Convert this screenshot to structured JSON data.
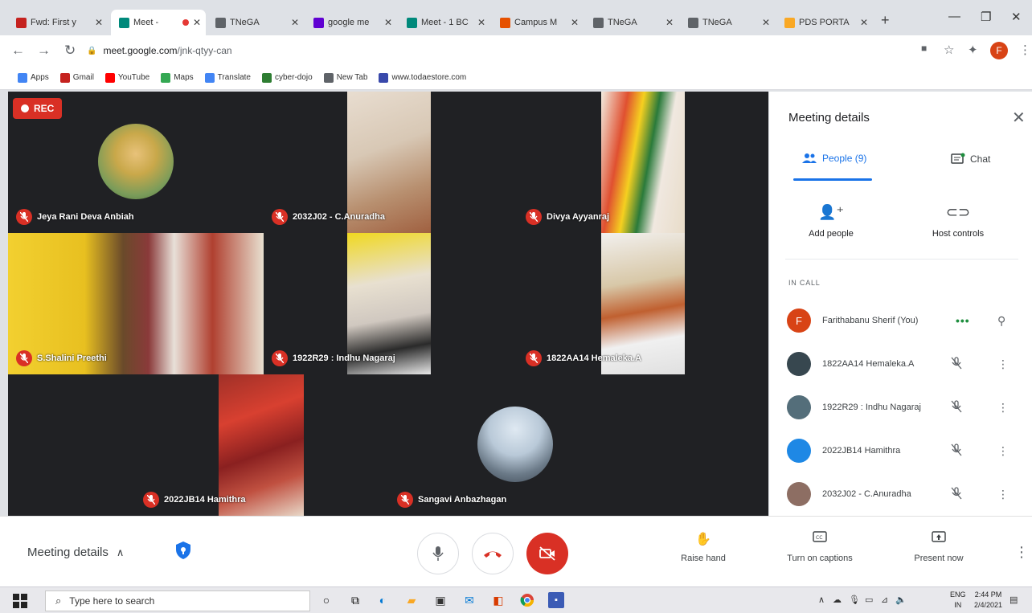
{
  "browser": {
    "tabs": [
      {
        "title": "Fwd: First y",
        "favicon": "gmail-icon",
        "color": "#c5221f"
      },
      {
        "title": "Meet - ",
        "favicon": "meet-icon",
        "color": "#00897b",
        "active": true,
        "recording": true
      },
      {
        "title": "TNeGA",
        "favicon": "globe-icon",
        "color": "#5f6368"
      },
      {
        "title": "google me",
        "favicon": "yahoo-icon",
        "color": "#6001d2"
      },
      {
        "title": "Meet - 1 BC",
        "favicon": "meet-icon",
        "color": "#00897b"
      },
      {
        "title": "Campus M",
        "favicon": "campus-icon",
        "color": "#e65100"
      },
      {
        "title": "TNeGA",
        "favicon": "globe-icon",
        "color": "#5f6368"
      },
      {
        "title": "TNeGA",
        "favicon": "globe-icon",
        "color": "#5f6368"
      },
      {
        "title": "PDS PORTA",
        "favicon": "pds-icon",
        "color": "#f9a825"
      }
    ],
    "url_domain": "meet.google.com",
    "url_path": "/jnk-qtyy-can",
    "profile_initial": "F",
    "bookmarks": [
      {
        "label": "Apps",
        "icon": "apps-grid-icon",
        "color": "#4285f4"
      },
      {
        "label": "Gmail",
        "icon": "gmail-icon",
        "color": "#c5221f"
      },
      {
        "label": "YouTube",
        "icon": "youtube-icon",
        "color": "#ff0000"
      },
      {
        "label": "Maps",
        "icon": "maps-icon",
        "color": "#34a853"
      },
      {
        "label": "Translate",
        "icon": "translate-icon",
        "color": "#4285f4"
      },
      {
        "label": "cyber-dojo",
        "icon": "cyber-dojo-icon",
        "color": "#2e7d32"
      },
      {
        "label": "New Tab",
        "icon": "globe-icon",
        "color": "#5f6368"
      },
      {
        "label": "www.todaestore.com",
        "icon": "store-icon",
        "color": "#3949ab"
      }
    ]
  },
  "meet": {
    "rec_label": "REC",
    "tiles": [
      {
        "name": "Jeya Rani Deva Anbiah",
        "kind": "avatar"
      },
      {
        "name": "2032J02 - C.Anuradha",
        "kind": "video"
      },
      {
        "name": "Divya Ayyanraj",
        "kind": "video"
      },
      {
        "name": "S.Shalini Preethi",
        "kind": "video"
      },
      {
        "name": "1922R29 : Indhu Nagaraj",
        "kind": "video"
      },
      {
        "name": "1822AA14 Hemaleka.A",
        "kind": "video"
      },
      {
        "name": "2022JB14 Hamithra",
        "kind": "video"
      },
      {
        "name": "Sangavi Anbazhagan",
        "kind": "avatar"
      }
    ],
    "panel": {
      "title": "Meeting details",
      "people_tab": "People (9)",
      "chat_tab": "Chat",
      "add_people": "Add people",
      "host_controls": "Host controls",
      "in_call_label": "IN CALL",
      "participants": [
        {
          "name": "Farithabanu Sherif (You)",
          "avatar_color": "#d84315",
          "initial": "F",
          "is_you": true
        },
        {
          "name": "1822AA14 Hemaleka.A",
          "avatar_color": "#37474f"
        },
        {
          "name": "1922R29 : Indhu Nagaraj",
          "avatar_color": "#546e7a"
        },
        {
          "name": "2022JB14 Hamithra",
          "avatar_color": "#1e88e5"
        },
        {
          "name": "2032J02 - C.Anuradha",
          "avatar_color": "#8d6e63"
        }
      ]
    },
    "bottom": {
      "meeting_details": "Meeting details",
      "raise_hand": "Raise hand",
      "captions": "Turn on captions",
      "present": "Present now"
    }
  },
  "taskbar": {
    "search_placeholder": "Type here to search",
    "lang_line1": "ENG",
    "lang_line2": "IN",
    "time": "2:44 PM",
    "date": "2/4/2021"
  }
}
